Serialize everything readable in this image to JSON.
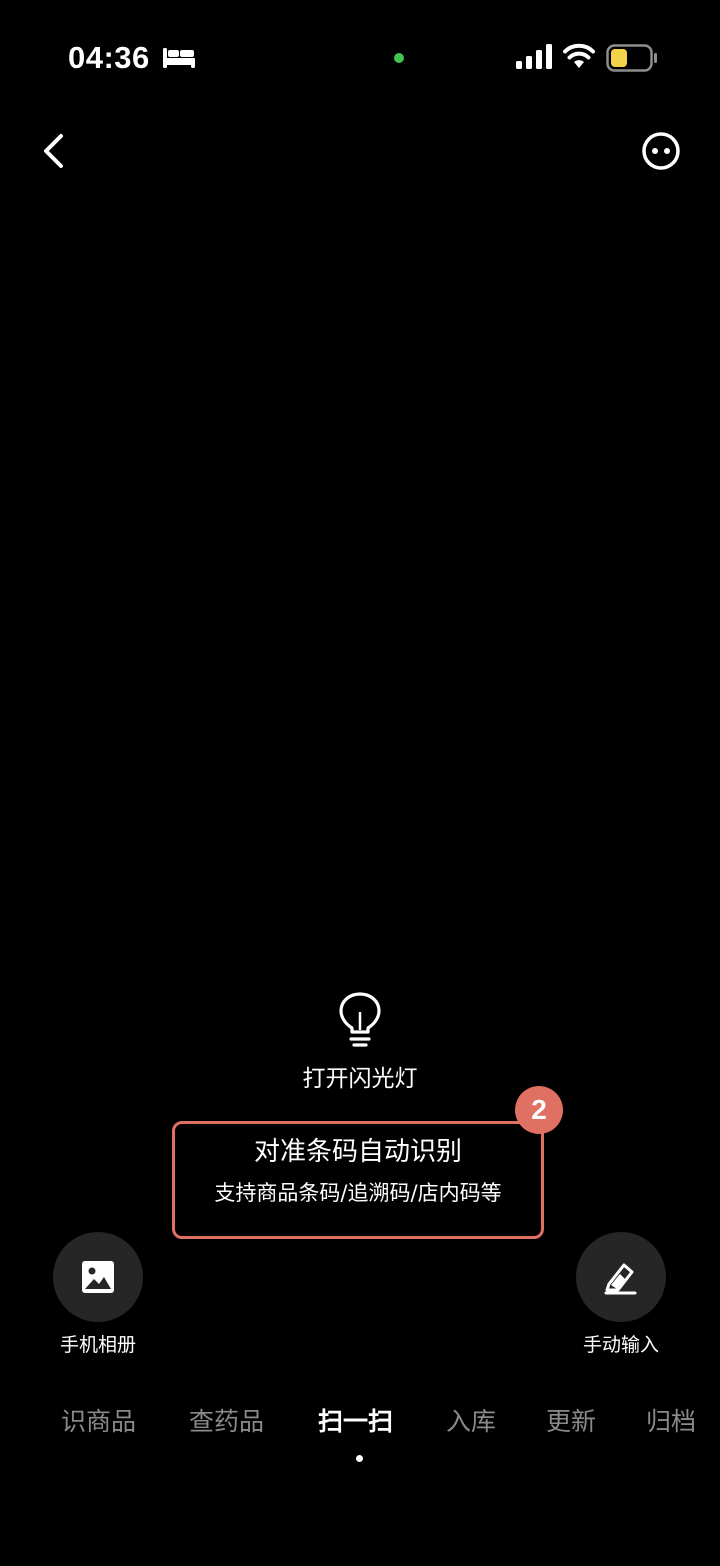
{
  "status_bar": {
    "time": "04:36",
    "sleep_icon": "bed-icon",
    "privacy_dot_color": "#3ec451",
    "battery_color": "#f4d24a"
  },
  "nav": {
    "back_icon": "chevron-left-icon",
    "more_icon": "more-circle-icon"
  },
  "flashlight": {
    "icon": "lightbulb-icon",
    "label": "打开闪光灯"
  },
  "hint": {
    "title": "对准条码自动识别",
    "subtitle": "支持商品条码/追溯码/店内码等",
    "badge": "2",
    "badge_color": "#e07062"
  },
  "album": {
    "icon": "image-icon",
    "label": "手机相册"
  },
  "manual_input": {
    "icon": "pencil-icon",
    "label": "手动输入"
  },
  "tabs": [
    {
      "label": "识商品",
      "active": false
    },
    {
      "label": "查药品",
      "active": false
    },
    {
      "label": "扫一扫",
      "active": true
    },
    {
      "label": "入库",
      "active": false
    },
    {
      "label": "更新",
      "active": false
    },
    {
      "label": "归档",
      "active": false
    }
  ]
}
